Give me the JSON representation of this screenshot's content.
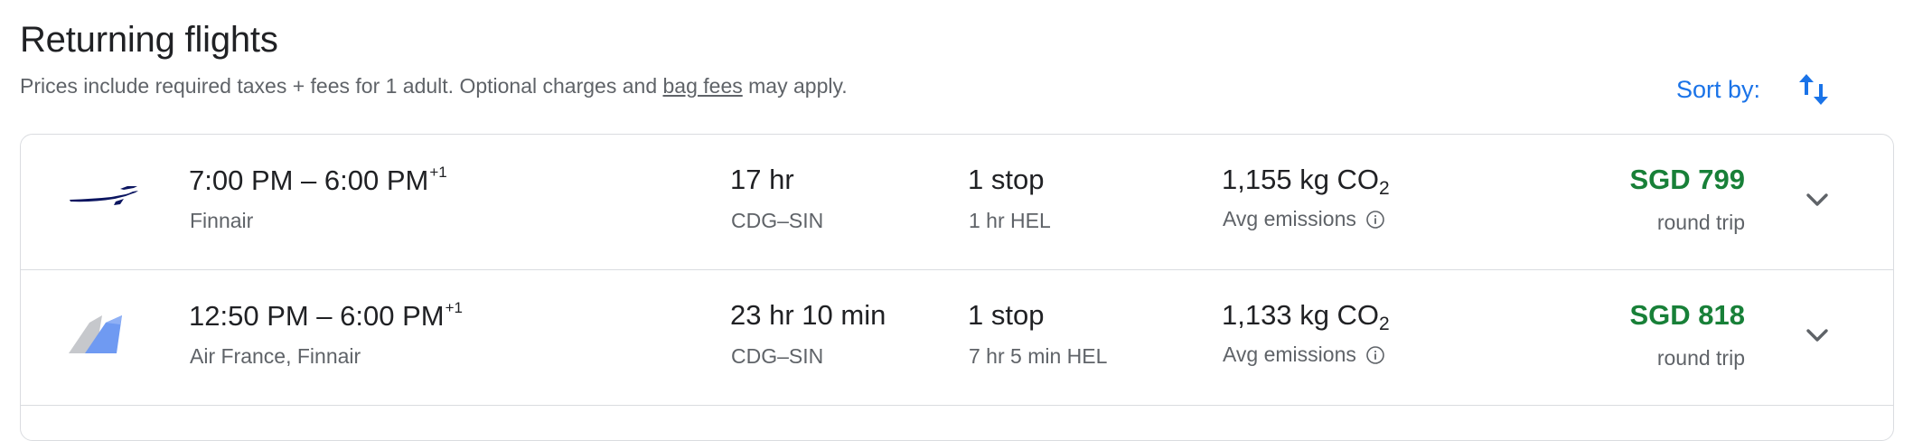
{
  "header": {
    "title": "Returning flights",
    "subtitle_before": "Prices include required taxes + fees for 1 adult. Optional charges and ",
    "subtitle_link": "bag fees",
    "subtitle_after": " may apply."
  },
  "sort": {
    "label": "Sort by:",
    "icon": "sort-arrows-icon"
  },
  "colors": {
    "accent": "#1a73e8",
    "price": "#188038",
    "secondary_text": "#5f6368",
    "border": "#dadce0"
  },
  "flights": [
    {
      "logo": "finnair-logo",
      "time_range": "7:00 PM – 6:00 PM",
      "day_offset": "+1",
      "airline": "Finnair",
      "duration": "17 hr",
      "route": "CDG–SIN",
      "stops": "1 stop",
      "layover": "1 hr HEL",
      "emissions_value": "1,155 kg CO",
      "emissions_sub": "2",
      "emissions_label": "Avg emissions",
      "price": "SGD 799",
      "price_type": "round trip"
    },
    {
      "logo": "air-france-finnair-logo",
      "time_range": "12:50 PM – 6:00 PM",
      "day_offset": "+1",
      "airline": "Air France, Finnair",
      "duration": "23 hr 10 min",
      "route": "CDG–SIN",
      "stops": "1 stop",
      "layover": "7 hr 5 min HEL",
      "emissions_value": "1,133 kg CO",
      "emissions_sub": "2",
      "emissions_label": "Avg emissions",
      "price": "SGD 818",
      "price_type": "round trip"
    }
  ]
}
